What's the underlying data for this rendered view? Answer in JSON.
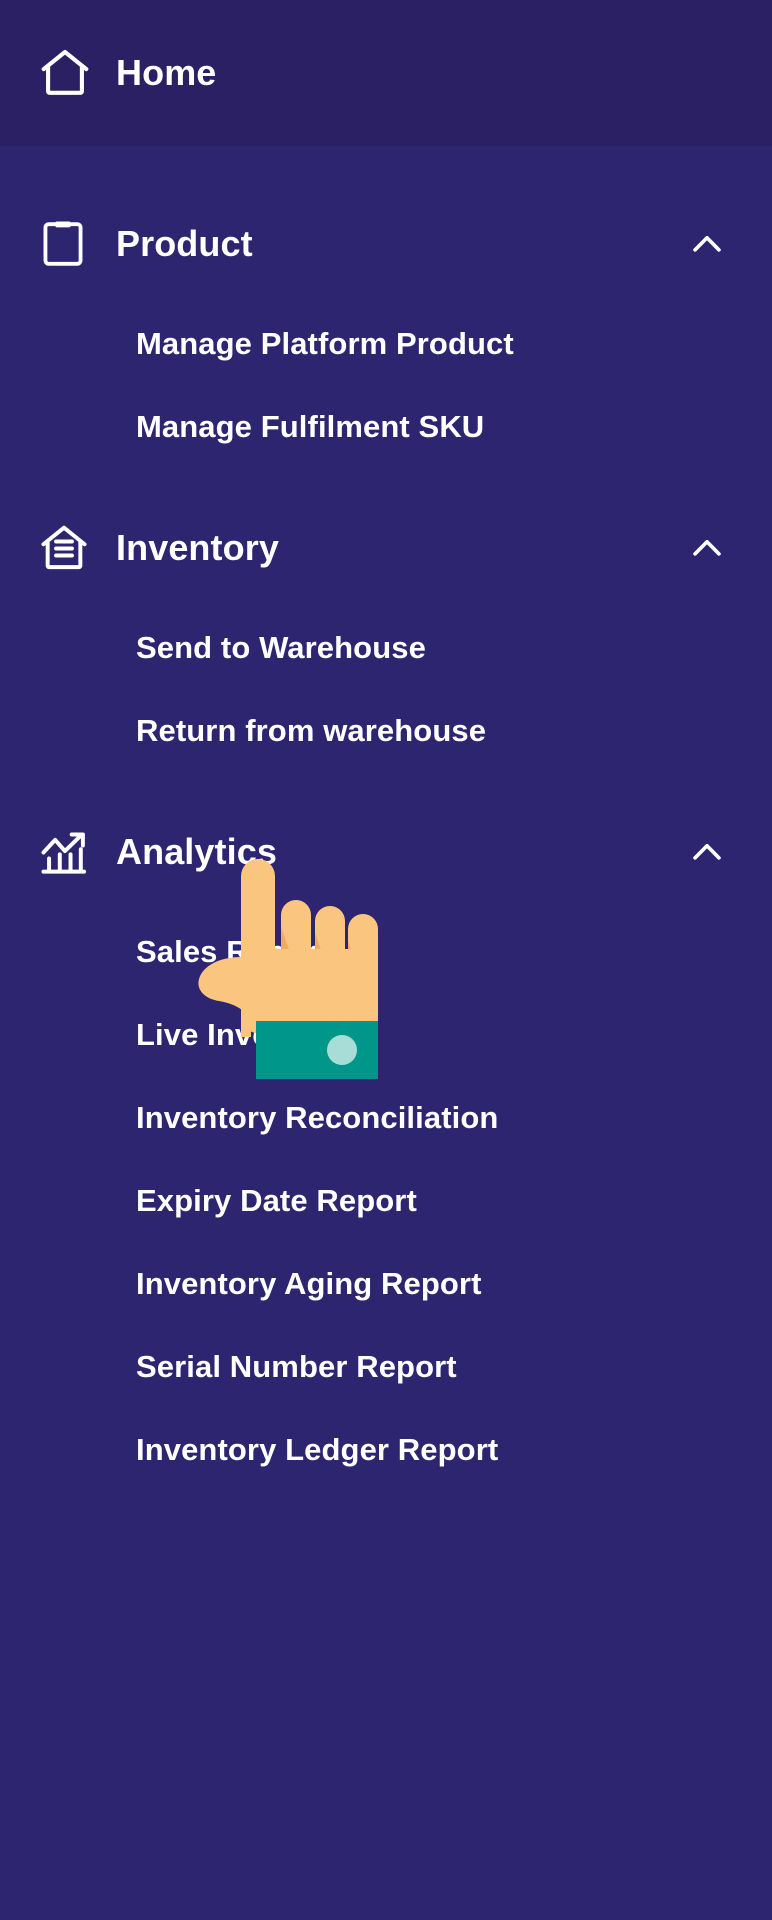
{
  "theme": {
    "sidebar_bg": "#2e2570",
    "home_bg": "#2a2063",
    "text_color": "#ffffff",
    "cursor_skin": "#fac57f",
    "cursor_skin_shadow": "#f0ab5e",
    "cursor_cuff": "#00968a",
    "cursor_cuff_button": "#a7ddd6"
  },
  "sidebar": {
    "home": {
      "label": "Home",
      "icon": "home-icon"
    },
    "groups": [
      {
        "id": "product",
        "label": "Product",
        "icon": "clipboard-icon",
        "chevron": "chevron-up-icon",
        "expanded": true,
        "items": [
          {
            "label": "Manage Platform Product"
          },
          {
            "label": "Manage Fulfilment SKU"
          }
        ]
      },
      {
        "id": "inventory",
        "label": "Inventory",
        "icon": "warehouse-icon",
        "chevron": "chevron-up-icon",
        "expanded": true,
        "items": [
          {
            "label": "Send to Warehouse"
          },
          {
            "label": "Return from warehouse"
          }
        ]
      },
      {
        "id": "analytics",
        "label": "Analytics",
        "icon": "chart-trend-icon",
        "chevron": "chevron-up-icon",
        "expanded": true,
        "items": [
          {
            "label": "Sales Report"
          },
          {
            "label": "Live Inventory"
          },
          {
            "label": "Inventory Reconciliation"
          },
          {
            "label": "Expiry Date Report"
          },
          {
            "label": "Inventory Aging Report"
          },
          {
            "label": "Serial Number Report"
          },
          {
            "label": "Inventory Ledger Report"
          }
        ]
      }
    ]
  },
  "cursor": {
    "type": "pointing-hand-cursor",
    "target": "Return from warehouse"
  }
}
